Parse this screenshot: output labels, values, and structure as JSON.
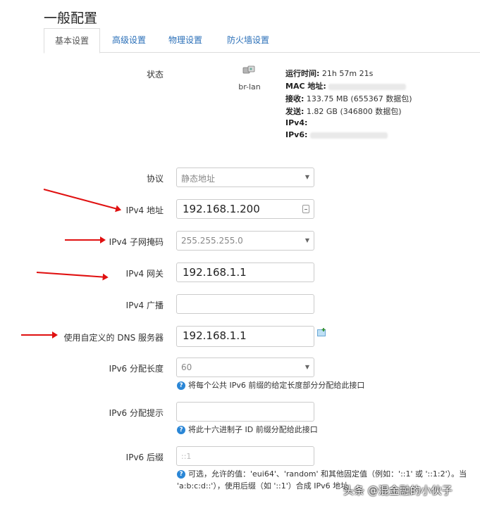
{
  "page": {
    "title": "一般配置"
  },
  "tabs": [
    {
      "label": "基本设置",
      "active": true
    },
    {
      "label": "高级设置",
      "active": false
    },
    {
      "label": "物理设置",
      "active": false
    },
    {
      "label": "防火墙设置",
      "active": false
    }
  ],
  "status": {
    "label": "状态",
    "iface": "br-lan",
    "uptime_label": "运行时间:",
    "uptime_value": "21h 57m 21s",
    "mac_label": "MAC 地址:",
    "rx_label": "接收:",
    "rx_value": "133.75 MB (655367 数据包)",
    "tx_label": "发送:",
    "tx_value": "1.82 GB (346800 数据包)",
    "ipv4_label": "IPv4:",
    "ipv6_label": "IPv6:"
  },
  "form": {
    "protocol": {
      "label": "协议",
      "value": "静态地址"
    },
    "ipv4_addr": {
      "label": "IPv4 地址",
      "value": "192.168.1.200"
    },
    "netmask": {
      "label": "IPv4 子网掩码",
      "value": "255.255.255.0"
    },
    "gateway": {
      "label": "IPv4 网关",
      "value": "192.168.1.1"
    },
    "broadcast": {
      "label": "IPv4 广播",
      "value": ""
    },
    "dns": {
      "label": "使用自定义的 DNS 服务器",
      "value": "192.168.1.1"
    },
    "ip6assign": {
      "label": "IPv6 分配长度",
      "value": "60",
      "help": "将每个公共 IPv6 前缀的给定长度部分分配给此接口"
    },
    "ip6hint": {
      "label": "IPv6 分配提示",
      "value": "",
      "help": "将此十六进制子 ID 前缀分配给此接口"
    },
    "ip6suffix": {
      "label": "IPv6 后缀",
      "placeholder": "::1",
      "help_line1": "可选，允许的值：'eui64'、'random' 和其他固定值（例如：'::1' 或 '::1:2'）。当",
      "help_line2": "'a:b:c:d::'），使用后缀（如 '::1'）合成 IPv6 地址"
    }
  },
  "watermark": "头条 @混金融的小伙子",
  "colors": {
    "link": "#2a6fb8",
    "arrow": "#e01010",
    "help_icon": "#2a86d6"
  }
}
